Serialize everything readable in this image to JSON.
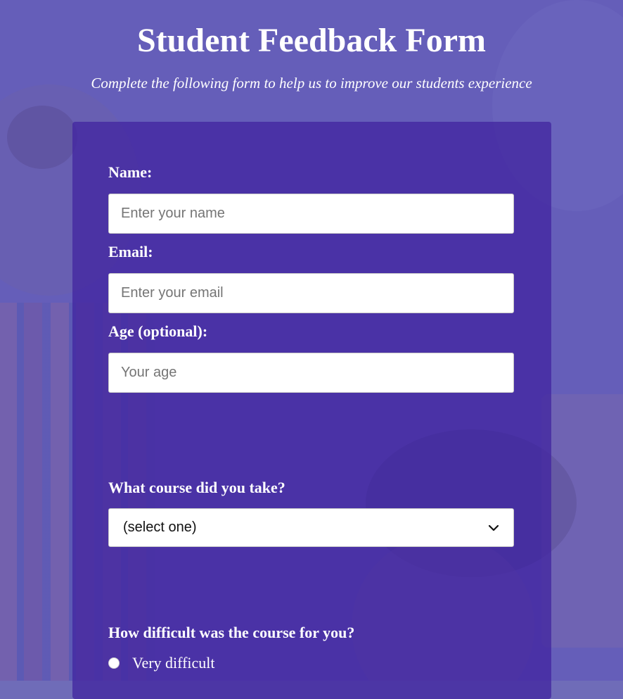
{
  "header": {
    "title": "Student Feedback Form",
    "subtitle": "Complete the following form to help us to improve our students experience"
  },
  "form": {
    "name": {
      "label": "Name:",
      "placeholder": "Enter your name",
      "value": ""
    },
    "email": {
      "label": "Email:",
      "placeholder": "Enter your email",
      "value": ""
    },
    "age": {
      "label": "Age (optional):",
      "placeholder": "Your age",
      "value": ""
    },
    "course": {
      "label": "What course did you take?",
      "selected": "(select one)"
    },
    "difficulty": {
      "label": "How difficult was the course for you?",
      "options": [
        {
          "label": "Very difficult",
          "checked": false
        }
      ]
    }
  },
  "colors": {
    "card_background": "#4226a0",
    "page_tint": "#5c54ba",
    "text": "#ffffff"
  },
  "icons": {
    "select_arrow": "chevron-down-icon",
    "radio": "radio-icon"
  }
}
